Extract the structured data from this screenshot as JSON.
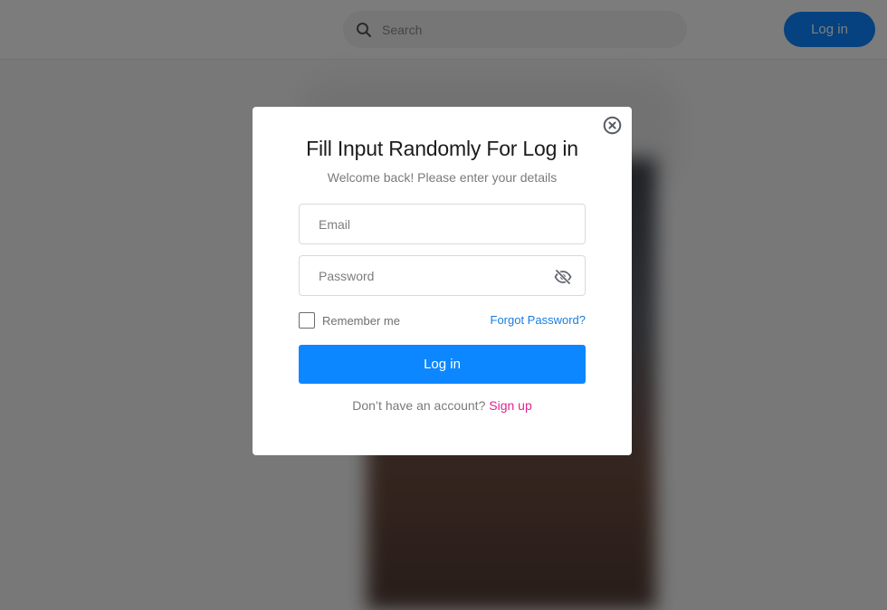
{
  "header": {
    "search_placeholder": "Search",
    "login_label": "Log in"
  },
  "modal": {
    "title": "Fill Input Randomly For Log in",
    "subtitle": "Welcome back! Please enter your details",
    "email_placeholder": "Email",
    "email_value": "",
    "password_placeholder": "Password",
    "password_value": "",
    "remember_label": "Remember me",
    "remember_checked": false,
    "forgot_label": "Forgot Password?",
    "login_label": "Log in",
    "signup_prompt": "Don’t have an account?",
    "signup_label": "Sign up"
  },
  "icons": {
    "search": "search-icon",
    "close": "close-circle-icon",
    "password_toggle": "eye-off-icon"
  },
  "colors": {
    "primary": "#0d87ff",
    "link": "#1a7ee0",
    "signup": "#e0248f",
    "overlay": "rgba(0,0,0,0.50)"
  }
}
